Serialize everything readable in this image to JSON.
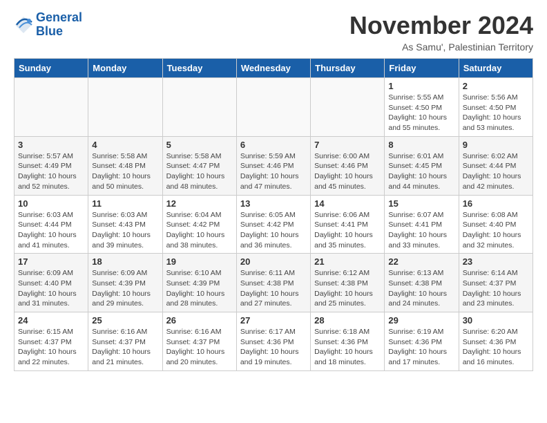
{
  "header": {
    "logo_line1": "General",
    "logo_line2": "Blue",
    "month_title": "November 2024",
    "location": "As Samu', Palestinian Territory"
  },
  "weekdays": [
    "Sunday",
    "Monday",
    "Tuesday",
    "Wednesday",
    "Thursday",
    "Friday",
    "Saturday"
  ],
  "weeks": [
    [
      {
        "day": "",
        "info": ""
      },
      {
        "day": "",
        "info": ""
      },
      {
        "day": "",
        "info": ""
      },
      {
        "day": "",
        "info": ""
      },
      {
        "day": "",
        "info": ""
      },
      {
        "day": "1",
        "info": "Sunrise: 5:55 AM\nSunset: 4:50 PM\nDaylight: 10 hours\nand 55 minutes."
      },
      {
        "day": "2",
        "info": "Sunrise: 5:56 AM\nSunset: 4:50 PM\nDaylight: 10 hours\nand 53 minutes."
      }
    ],
    [
      {
        "day": "3",
        "info": "Sunrise: 5:57 AM\nSunset: 4:49 PM\nDaylight: 10 hours\nand 52 minutes."
      },
      {
        "day": "4",
        "info": "Sunrise: 5:58 AM\nSunset: 4:48 PM\nDaylight: 10 hours\nand 50 minutes."
      },
      {
        "day": "5",
        "info": "Sunrise: 5:58 AM\nSunset: 4:47 PM\nDaylight: 10 hours\nand 48 minutes."
      },
      {
        "day": "6",
        "info": "Sunrise: 5:59 AM\nSunset: 4:46 PM\nDaylight: 10 hours\nand 47 minutes."
      },
      {
        "day": "7",
        "info": "Sunrise: 6:00 AM\nSunset: 4:46 PM\nDaylight: 10 hours\nand 45 minutes."
      },
      {
        "day": "8",
        "info": "Sunrise: 6:01 AM\nSunset: 4:45 PM\nDaylight: 10 hours\nand 44 minutes."
      },
      {
        "day": "9",
        "info": "Sunrise: 6:02 AM\nSunset: 4:44 PM\nDaylight: 10 hours\nand 42 minutes."
      }
    ],
    [
      {
        "day": "10",
        "info": "Sunrise: 6:03 AM\nSunset: 4:44 PM\nDaylight: 10 hours\nand 41 minutes."
      },
      {
        "day": "11",
        "info": "Sunrise: 6:03 AM\nSunset: 4:43 PM\nDaylight: 10 hours\nand 39 minutes."
      },
      {
        "day": "12",
        "info": "Sunrise: 6:04 AM\nSunset: 4:42 PM\nDaylight: 10 hours\nand 38 minutes."
      },
      {
        "day": "13",
        "info": "Sunrise: 6:05 AM\nSunset: 4:42 PM\nDaylight: 10 hours\nand 36 minutes."
      },
      {
        "day": "14",
        "info": "Sunrise: 6:06 AM\nSunset: 4:41 PM\nDaylight: 10 hours\nand 35 minutes."
      },
      {
        "day": "15",
        "info": "Sunrise: 6:07 AM\nSunset: 4:41 PM\nDaylight: 10 hours\nand 33 minutes."
      },
      {
        "day": "16",
        "info": "Sunrise: 6:08 AM\nSunset: 4:40 PM\nDaylight: 10 hours\nand 32 minutes."
      }
    ],
    [
      {
        "day": "17",
        "info": "Sunrise: 6:09 AM\nSunset: 4:40 PM\nDaylight: 10 hours\nand 31 minutes."
      },
      {
        "day": "18",
        "info": "Sunrise: 6:09 AM\nSunset: 4:39 PM\nDaylight: 10 hours\nand 29 minutes."
      },
      {
        "day": "19",
        "info": "Sunrise: 6:10 AM\nSunset: 4:39 PM\nDaylight: 10 hours\nand 28 minutes."
      },
      {
        "day": "20",
        "info": "Sunrise: 6:11 AM\nSunset: 4:38 PM\nDaylight: 10 hours\nand 27 minutes."
      },
      {
        "day": "21",
        "info": "Sunrise: 6:12 AM\nSunset: 4:38 PM\nDaylight: 10 hours\nand 25 minutes."
      },
      {
        "day": "22",
        "info": "Sunrise: 6:13 AM\nSunset: 4:38 PM\nDaylight: 10 hours\nand 24 minutes."
      },
      {
        "day": "23",
        "info": "Sunrise: 6:14 AM\nSunset: 4:37 PM\nDaylight: 10 hours\nand 23 minutes."
      }
    ],
    [
      {
        "day": "24",
        "info": "Sunrise: 6:15 AM\nSunset: 4:37 PM\nDaylight: 10 hours\nand 22 minutes."
      },
      {
        "day": "25",
        "info": "Sunrise: 6:16 AM\nSunset: 4:37 PM\nDaylight: 10 hours\nand 21 minutes."
      },
      {
        "day": "26",
        "info": "Sunrise: 6:16 AM\nSunset: 4:37 PM\nDaylight: 10 hours\nand 20 minutes."
      },
      {
        "day": "27",
        "info": "Sunrise: 6:17 AM\nSunset: 4:36 PM\nDaylight: 10 hours\nand 19 minutes."
      },
      {
        "day": "28",
        "info": "Sunrise: 6:18 AM\nSunset: 4:36 PM\nDaylight: 10 hours\nand 18 minutes."
      },
      {
        "day": "29",
        "info": "Sunrise: 6:19 AM\nSunset: 4:36 PM\nDaylight: 10 hours\nand 17 minutes."
      },
      {
        "day": "30",
        "info": "Sunrise: 6:20 AM\nSunset: 4:36 PM\nDaylight: 10 hours\nand 16 minutes."
      }
    ]
  ]
}
